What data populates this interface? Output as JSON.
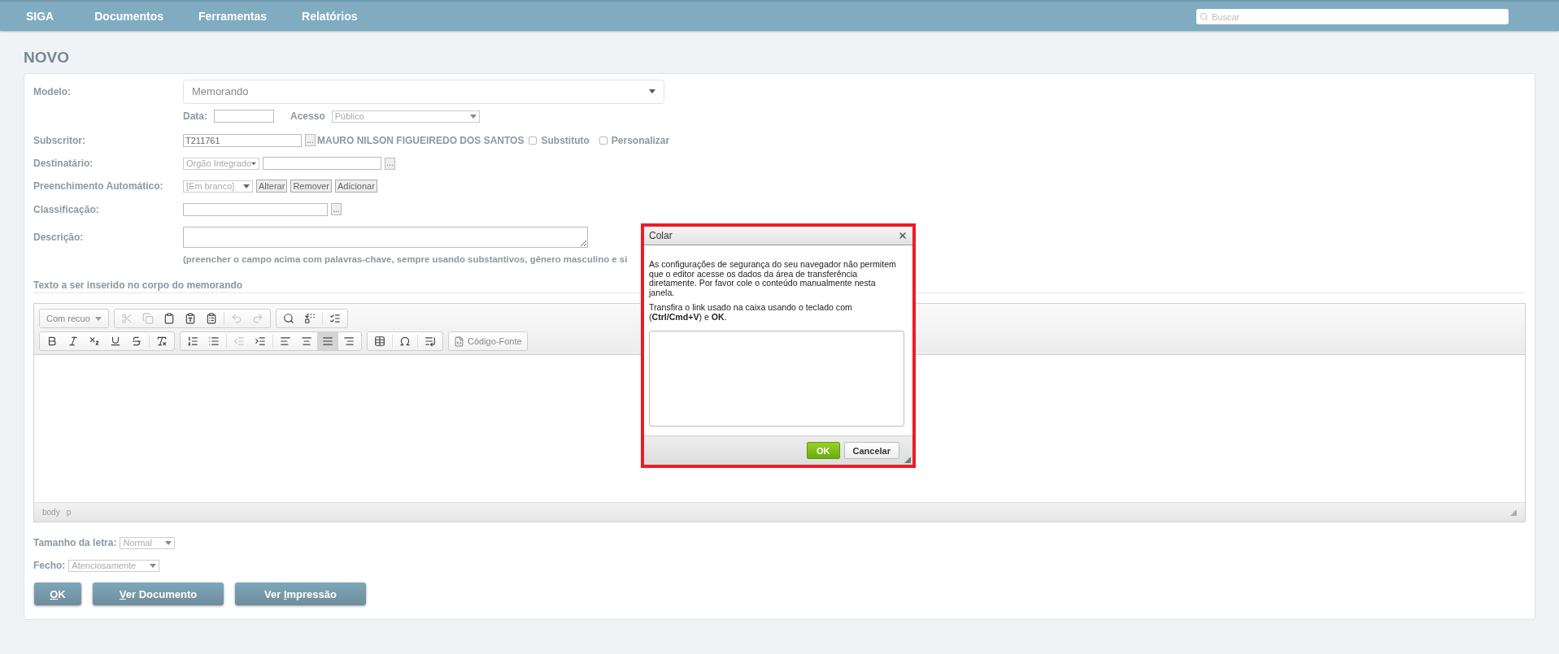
{
  "nav": {
    "brand": "SIGA",
    "items": [
      "Documentos",
      "Ferramentas",
      "Relatórios"
    ],
    "search": {
      "placeholder": "Buscar"
    }
  },
  "page_title": "NOVO",
  "form": {
    "modelo": {
      "label": "Modelo:",
      "value": "Memorando"
    },
    "data": {
      "label": "Data:"
    },
    "acesso": {
      "label": "Acesso",
      "value": "Público"
    },
    "subscritor": {
      "label": "Subscritor:",
      "value": "T211761",
      "lookup": "...",
      "name": "MAURO NILSON FIGUEIREDO DOS SANTOS",
      "checkboxes": [
        {
          "label": "Substituto",
          "checked": false
        },
        {
          "label": "Personalizar",
          "checked": false
        }
      ]
    },
    "destinatario": {
      "label": "Destinatário:",
      "type": "Orgão Integrado",
      "lookup": "..."
    },
    "preenchimento": {
      "label": "Preenchimento Automático:",
      "value": "[Em branco]",
      "buttons": [
        "Alterar",
        "Remover",
        "Adicionar"
      ]
    },
    "classificacao": {
      "label": "Classificação:",
      "lookup": "..."
    },
    "descricao": {
      "label": "Descrição:",
      "hint": "(preencher o campo acima com palavras-chave, sempre usando substantivos, gênero masculino e si"
    }
  },
  "editor": {
    "heading": "Texto a ser inserido no corpo do memorando",
    "style_combo": "Com recuo",
    "buttons": [
      {
        "disabled": true,
        "selected": false
      },
      {
        "disabled": true,
        "selected": false
      },
      {
        "disabled": false,
        "selected": false
      },
      {
        "disabled": false,
        "selected": false
      },
      {
        "disabled": false,
        "selected": false
      },
      {
        "disabled": true,
        "selected": false
      },
      {
        "disabled": true,
        "selected": false
      },
      {
        "disabled": false,
        "selected": false
      },
      {
        "disabled": false,
        "selected": false
      },
      {
        "disabled": false,
        "selected": false
      },
      {
        "disabled": false,
        "selected": false
      },
      {
        "disabled": false,
        "selected": false
      },
      {
        "disabled": false,
        "selected": false
      },
      {
        "disabled": false,
        "selected": false
      },
      {
        "disabled": false,
        "selected": false
      },
      {
        "disabled": false,
        "selected": false
      },
      {
        "disabled": false,
        "selected": false
      },
      {
        "disabled": false,
        "selected": false
      },
      {
        "disabled": true,
        "selected": false
      },
      {
        "disabled": false,
        "selected": false
      },
      {
        "disabled": false,
        "selected": false
      },
      {
        "disabled": false,
        "selected": false
      },
      {
        "disabled": false,
        "selected": true
      },
      {
        "disabled": false,
        "selected": false
      },
      {
        "disabled": false,
        "selected": false
      },
      {
        "disabled": false,
        "selected": false
      },
      {
        "disabled": false,
        "selected": false
      }
    ],
    "source_button": "Código-Fonte",
    "path": [
      "body",
      "p"
    ]
  },
  "font_size": {
    "label": "Tamanho da letra:",
    "value": "Normal"
  },
  "fecho": {
    "label": "Fecho:",
    "value": "Atenciosamente"
  },
  "actions": [
    {
      "key": "O",
      "after": "K"
    },
    {
      "key": "V",
      "after": "er Documento"
    },
    {
      "before": "Ver ",
      "key": "I",
      "after": "mpressão"
    }
  ],
  "dialog": {
    "title": "Colar",
    "paragraphs": [
      "As configurações de segurança do seu navegador não permitem que o editor acesse os dados da área de transferência diretamente. Por favor cole o conteúdo manualmente nesta janela.",
      "Transfira o link usado na caixa usando o teclado com (**Ctrl/Cmd+V**) e **OK**."
    ],
    "buttons": [
      {
        "label": "OK",
        "kind": "primary"
      },
      {
        "label": "Cancelar",
        "kind": "secondary"
      }
    ]
  }
}
